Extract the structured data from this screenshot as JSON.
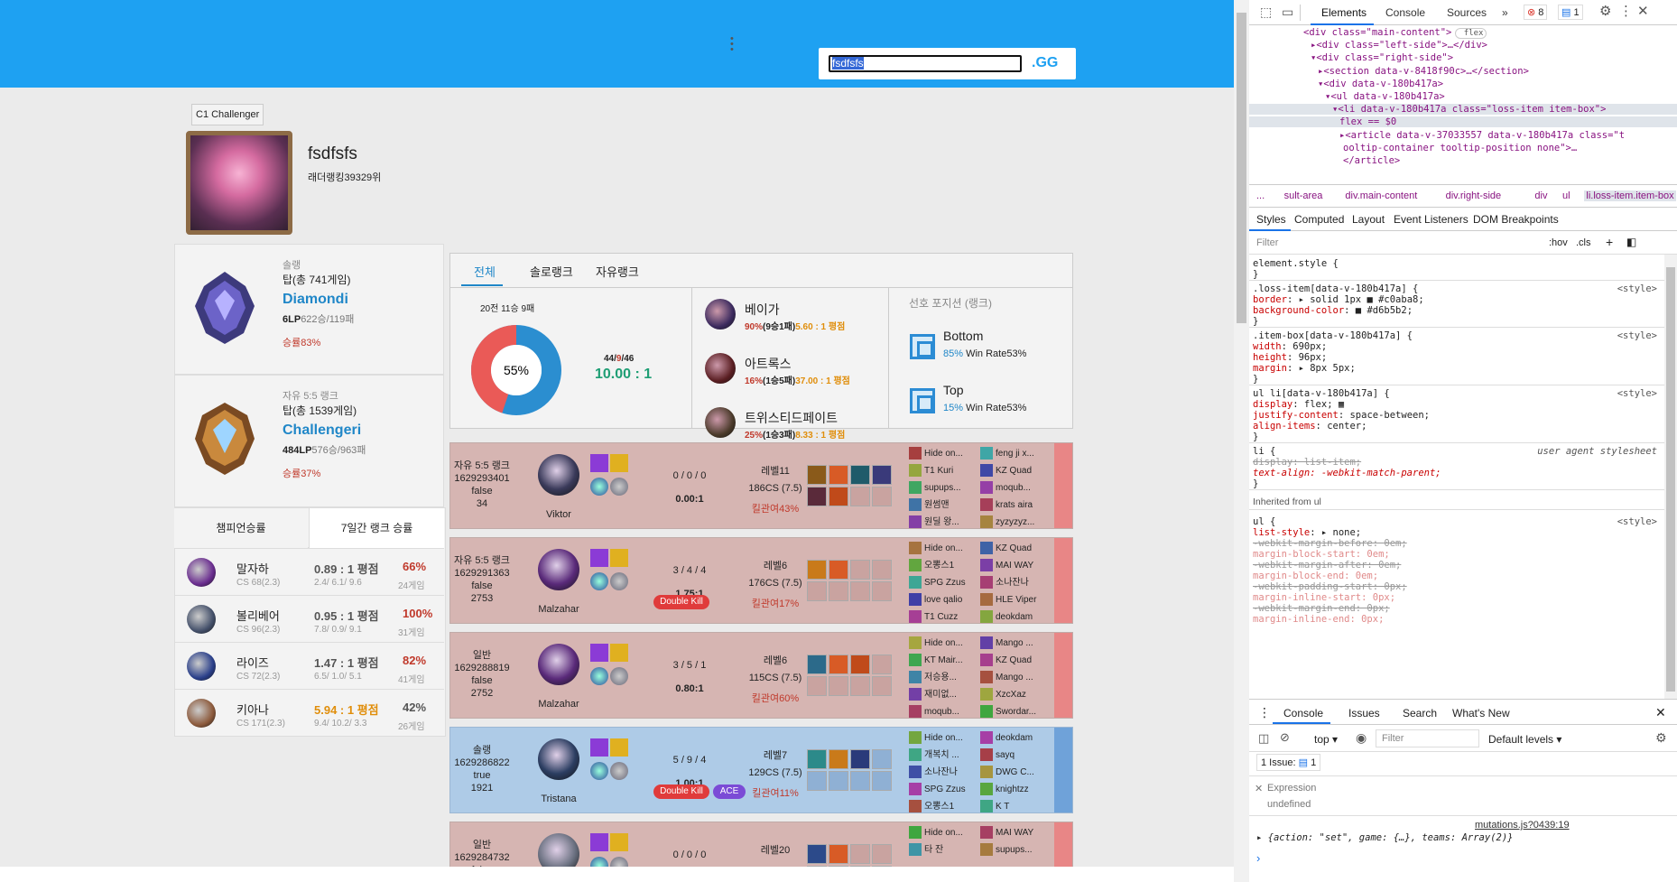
{
  "search": {
    "value": "fsdfsfs",
    "gg": ".GG"
  },
  "profile": {
    "tier_chip": "C1 Challenger",
    "name": "fsdfsfs",
    "ladder": "래더랭킹39329위"
  },
  "solo": {
    "title": "솔랭",
    "line": "탑(총 741게임)",
    "tier": "Diamondi",
    "lp": "6LP",
    "record": "622승/119패",
    "winrate": "승률83%"
  },
  "flex": {
    "title": "자유 5:5 랭크",
    "line": "탑(총 1539게임)",
    "tier": "Challengeri",
    "lp": "484LP",
    "record": "576승/963패",
    "winrate": "승률37%"
  },
  "champ_tabs": [
    "챔피언승률",
    "7일간 랭크 승률"
  ],
  "champs": [
    {
      "name": "말자하",
      "cs": "CS 68(2.3)",
      "kda": "0.89 : 1 평점",
      "kdad": "2.4/ 6.1/ 9.6",
      "wr": "66%",
      "games": "24게임",
      "wr_color": "#c0392b",
      "kda_color": "#555",
      "icon": "#6a2d8f"
    },
    {
      "name": "볼리베어",
      "cs": "CS 96(2.3)",
      "kda": "0.95 : 1 평점",
      "kdad": "7.8/ 0.9/ 9.1",
      "wr": "100%",
      "games": "31게임",
      "wr_color": "#c0392b",
      "kda_color": "#555",
      "icon": "#44506a"
    },
    {
      "name": "라이즈",
      "cs": "CS 72(2.3)",
      "kda": "1.47 : 1 평점",
      "kdad": "6.5/ 1.0/ 5.1",
      "wr": "82%",
      "games": "41게임",
      "wr_color": "#c0392b",
      "kda_color": "#555",
      "icon": "#2a3f8a"
    },
    {
      "name": "키아나",
      "cs": "CS 171(2.3)",
      "kda": "5.94 : 1 평점",
      "kdad": "9.4/ 10.2/ 3.3",
      "wr": "42%",
      "games": "26게임",
      "wr_color": "#555",
      "kda_color": "#e08e0b",
      "icon": "#8c5a3c"
    }
  ],
  "summary": {
    "tabs": [
      "전체",
      "솔로랭크",
      "자유랭크"
    ],
    "record": "20전 11승 9패",
    "pct": "55%",
    "pct_value": 55,
    "kda_k": "44",
    "kda_d": "9",
    "kda_a": "46",
    "kda_ratio": "10.00 : 1",
    "most": [
      {
        "name": "베이가",
        "pre": "90%",
        "mid": "(9승1패)",
        "kda": "5.60 : 1 평점",
        "color": "#3b2a5e"
      },
      {
        "name": "아트록스",
        "pre": "16%",
        "mid": "(1승5패)",
        "kda": "37.00 : 1 평점",
        "color": "#5a1e22"
      },
      {
        "name": "트위스티드페이트",
        "pre": "25%",
        "mid": "(1승3패)",
        "kda": "8.33 : 1 평점",
        "color": "#4a3a2a"
      }
    ],
    "pos_title": "선호 포지션 (랭크)",
    "positions": [
      {
        "name": "Bottom",
        "pct": "85%",
        "wr": "Win Rate53%"
      },
      {
        "name": "Top",
        "pct": "15%",
        "wr": "Win Rate53%"
      }
    ]
  },
  "matches": [
    {
      "queue": "자유 5:5 랭크",
      "id": "1629293401",
      "win": "false",
      "dur": "34",
      "champ": "Viktor",
      "k": "0 / 0 / 0",
      "r": "0.00:1",
      "lv": "레벨11",
      "cs": "186CS (7.5)",
      "kp": "킬관여43%",
      "badges": [],
      "color": "#3a3a5a",
      "team1": [
        "Hide on...",
        "T1 Kuri",
        "supups...",
        "원썸맨",
        "원딜 왕..."
      ],
      "team2": [
        "feng ji x...",
        "KZ Quad",
        "moqub...",
        "krats aira",
        "zyzyzyz..."
      ]
    },
    {
      "queue": "자유 5:5 랭크",
      "id": "1629291363",
      "win": "false",
      "dur": "2753",
      "champ": "Malzahar",
      "k": "3 / 4 / 4",
      "r": "1.75:1",
      "lv": "레벨6",
      "cs": "176CS (7.5)",
      "kp": "킬관여17%",
      "badges": [
        {
          "t": "Double Kill",
          "c": "#e03b3b",
          "w": 54
        }
      ],
      "color": "#5a2a7a",
      "team1": [
        "Hide on...",
        "오뽕스1",
        "SPG Zzus",
        "love qalio",
        "T1 Cuzz"
      ],
      "team2": [
        "KZ Quad",
        "MAI WAY",
        "소나잔나",
        "HLE Viper",
        "deokdam"
      ]
    },
    {
      "queue": "일반",
      "id": "1629288819",
      "win": "false",
      "dur": "2752",
      "champ": "Malzahar",
      "k": "3 / 5 / 1",
      "r": "0.80:1",
      "lv": "레벨6",
      "cs": "115CS (7.5)",
      "kp": "킬관여60%",
      "badges": [],
      "color": "#5a2a7a",
      "team1": [
        "Hide on...",
        "KT Mair...",
        "저승용...",
        "재미없...",
        "moqub..."
      ],
      "team2": [
        "Mango ...",
        "KZ Quad",
        "Mango ...",
        "XzcXaz",
        "Swordar..."
      ]
    },
    {
      "queue": "솔랭",
      "id": "1629286822",
      "win": "true",
      "dur": "1921",
      "champ": "Tristana",
      "k": "5 / 9 / 4",
      "r": "1.00:1",
      "lv": "레벨7",
      "cs": "129CS (7.5)",
      "kp": "킬관여11%",
      "badges": [
        {
          "t": "Double Kill",
          "c": "#e03b3b",
          "w": 54
        },
        {
          "t": "ACE",
          "c": "#7b4bd6",
          "w": 28
        }
      ],
      "color": "#2c3e62",
      "team1": [
        "Hide on...",
        "개복치 ...",
        "소나잔나",
        "SPG Zzus",
        "오뽕스1"
      ],
      "team2": [
        "deokdam",
        "sayq",
        "DWG C...",
        "knightzz",
        "K T"
      ]
    },
    {
      "queue": "일반",
      "id": "1629284732",
      "win": "false",
      "dur": "",
      "champ": "",
      "k": "0 / 0 / 0",
      "r": "",
      "lv": "레벨20",
      "cs": "",
      "kp": "",
      "badges": [],
      "color": "#6a7080",
      "team1": [
        "Hide on...",
        "타 잔"
      ],
      "team2": [
        "MAI WAY",
        "supups..."
      ]
    }
  ],
  "devtools": {
    "tabs": [
      "Elements",
      "Console",
      "Sources"
    ],
    "errors": "8",
    "issues_badge": "1",
    "dom_lines": [
      {
        "ind": 60,
        "txt": "<div class=\"main-content\">",
        "flex": true
      },
      {
        "ind": 68,
        "txt": "▸<div class=\"left-side\">…</div>"
      },
      {
        "ind": 68,
        "txt": "▾<div class=\"right-side\">"
      },
      {
        "ind": 76,
        "txt": "▸<section data-v-8418f90c>…</section>"
      },
      {
        "ind": 76,
        "txt": "▾<div data-v-180b417a>"
      },
      {
        "ind": 84,
        "txt": "▾<ul data-v-180b417a>"
      },
      {
        "ind": 92,
        "txt": "▾<li data-v-180b417a class=\"loss-item item-box\">"
      },
      {
        "ind": 100,
        "txt": "flex  == $0"
      },
      {
        "ind": 100,
        "txt": "▸<article data-v-37033557 data-v-180b417a class=\"t"
      },
      {
        "ind": 104,
        "txt": "ooltip-container tooltip-position none\">…"
      },
      {
        "ind": 104,
        "txt": "</article>"
      }
    ],
    "crumbs": [
      "...",
      "sult-area",
      "div.main-content",
      "div.right-side",
      "div",
      "ul",
      "li.loss-item.item-box",
      "..."
    ],
    "style_tabs": [
      "Styles",
      "Computed",
      "Layout",
      "Event Listeners",
      "DOM Breakpoints"
    ],
    "filter": "Filter",
    "hov": ":hov",
    "cls": ".cls",
    "console_tabs": [
      "Console",
      "Issues",
      "Search",
      "What's New"
    ],
    "console_top": "top",
    "console_filter": "Filter",
    "default_levels": "Default levels",
    "issue_count": "1 Issue:",
    "issue_badge": "1",
    "expression": "Expression",
    "undefined": "undefined",
    "source_link": "mutations.js?0439:19",
    "log": "{action: \"set\", game: {…}, teams: Array(2)}"
  }
}
